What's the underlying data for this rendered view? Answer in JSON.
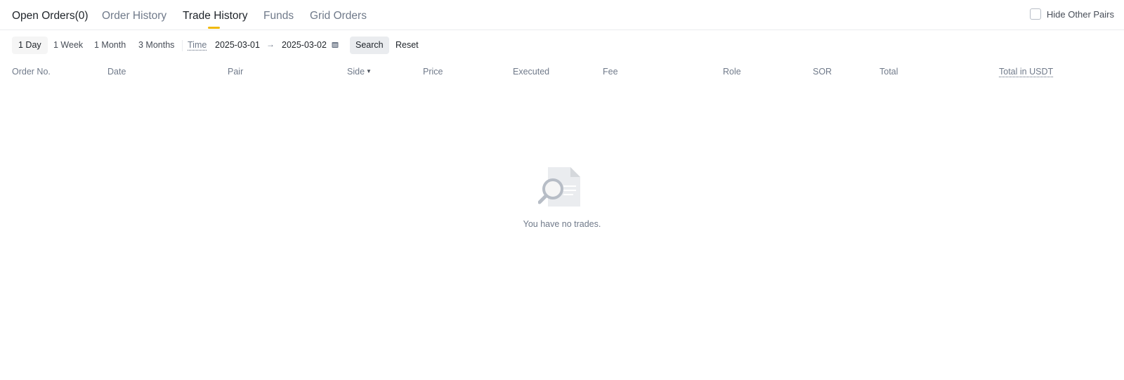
{
  "tabs": [
    {
      "label": "Open Orders(0)"
    },
    {
      "label": "Order History"
    },
    {
      "label": "Trade History"
    },
    {
      "label": "Funds"
    },
    {
      "label": "Grid Orders"
    }
  ],
  "active_tab": "Trade History",
  "hide_other_pairs": {
    "label": "Hide Other Pairs",
    "checked": false
  },
  "filters": {
    "periods": [
      "1 Day",
      "1 Week",
      "1 Month",
      "3 Months"
    ],
    "selected_period": "1 Day",
    "time_label": "Time",
    "start_date": "2025-03-01",
    "end_date": "2025-03-02",
    "search_label": "Search",
    "reset_label": "Reset"
  },
  "table": {
    "columns": [
      "Order No.",
      "Date",
      "Pair",
      "Side",
      "Price",
      "Executed",
      "Fee",
      "Role",
      "SOR",
      "Total",
      "Total in USDT"
    ],
    "rows": []
  },
  "empty_state": {
    "message": "You have no trades.",
    "icon": "no-data-search-icon"
  },
  "colors": {
    "accent": "#f0b90b",
    "text_primary": "#1e2329",
    "text_secondary": "#707a8a",
    "border": "#eaecef"
  }
}
